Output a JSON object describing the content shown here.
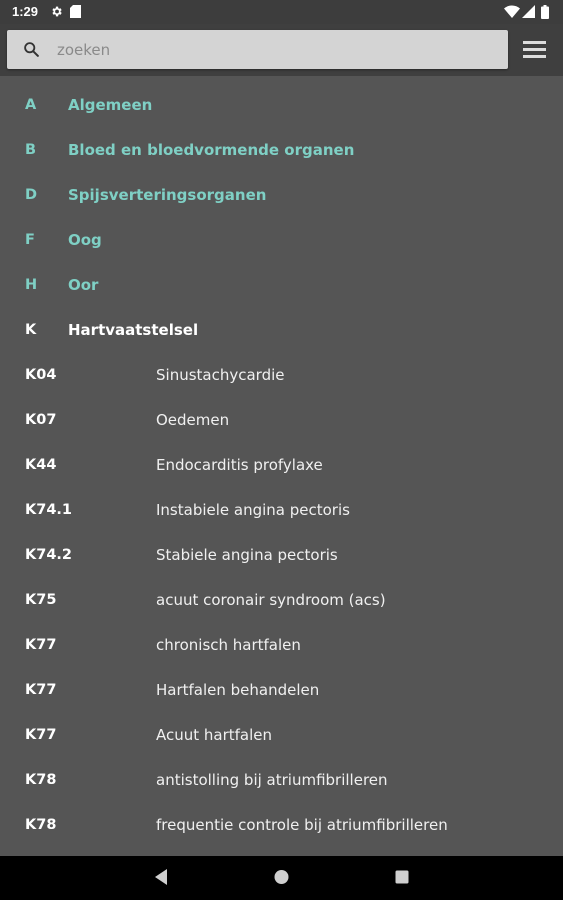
{
  "status_bar": {
    "time": "1:29"
  },
  "search": {
    "placeholder": "zoeken",
    "value": ""
  },
  "colors": {
    "background": "#555555",
    "app_bar": "#3f3f3f",
    "chapter_accent": "#7fd0c5",
    "active_chapter": "#ffffff"
  },
  "chapters": [
    {
      "code": "A",
      "name": "Algemeen"
    },
    {
      "code": "B",
      "name": "Bloed en bloedvormende organen"
    },
    {
      "code": "D",
      "name": "Spijsverteringsorganen"
    },
    {
      "code": "F",
      "name": "Oog"
    },
    {
      "code": "H",
      "name": "Oor"
    }
  ],
  "active_chapter": {
    "code": "K",
    "name": "Hartvaatstelsel"
  },
  "entries": [
    {
      "code": "K04",
      "name": "Sinustachycardie"
    },
    {
      "code": "K07",
      "name": "Oedemen"
    },
    {
      "code": "K44",
      "name": "Endocarditis profylaxe"
    },
    {
      "code": "K74.1",
      "name": "Instabiele angina pectoris"
    },
    {
      "code": "K74.2",
      "name": "Stabiele angina pectoris"
    },
    {
      "code": "K75",
      "name": "acuut coronair syndroom (acs)"
    },
    {
      "code": "K77",
      "name": "chronisch hartfalen"
    },
    {
      "code": "K77",
      "name": "Hartfalen behandelen"
    },
    {
      "code": "K77",
      "name": "Acuut hartfalen"
    },
    {
      "code": "K78",
      "name": "antistolling bij atriumfibrilleren"
    },
    {
      "code": "K78",
      "name": "frequentie controle bij atriumfibrilleren"
    }
  ],
  "icons": {
    "status": [
      "settings-icon",
      "sd-card-icon",
      "wifi-icon",
      "signal-icon",
      "battery-icon"
    ],
    "search": "search-icon",
    "menu": "menu-icon",
    "nav": [
      "back-icon",
      "home-icon",
      "recents-icon"
    ]
  }
}
